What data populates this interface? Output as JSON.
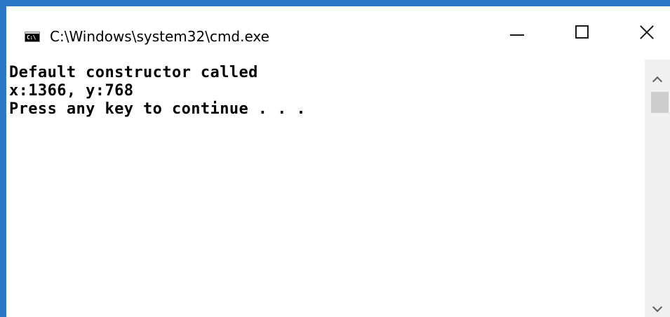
{
  "window": {
    "title": "C:\\Windows\\system32\\cmd.exe",
    "icon": "cmd-prompt-icon",
    "icon_text": "C:\\",
    "accent_color": "#2b79c6"
  },
  "caption_buttons": {
    "minimize_icon": "minimize-icon",
    "maximize_icon": "maximize-icon",
    "close_icon": "close-icon"
  },
  "console": {
    "lines": [
      "Default constructor called",
      "x:1366, y:768",
      "Press any key to continue . . ."
    ]
  },
  "scrollbar": {
    "up_icon": "chevron-up-icon",
    "down_icon": "chevron-down-icon"
  }
}
